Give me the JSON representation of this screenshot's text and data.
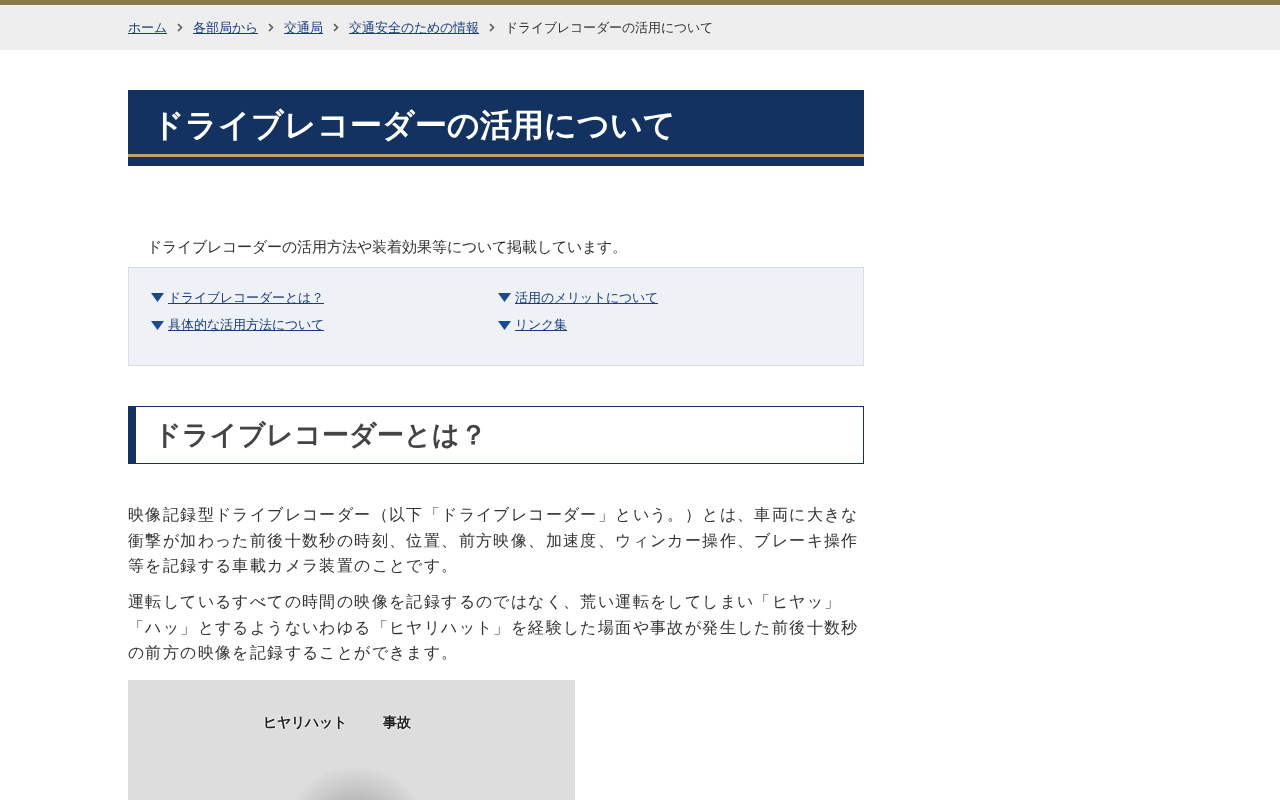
{
  "breadcrumb": [
    {
      "label": "ホーム",
      "link": true
    },
    {
      "label": "各部局から",
      "link": true
    },
    {
      "label": "交通局",
      "link": true
    },
    {
      "label": "交通安全のための情報",
      "link": true
    },
    {
      "label": "ドライブレコーダーの活用について",
      "link": false
    }
  ],
  "page_title": "ドライブレコーダーの活用について",
  "intro": "ドライブレコーダーの活用方法や装着効果等について掲載しています。",
  "toc": [
    {
      "label": "ドライブレコーダーとは？"
    },
    {
      "label": "活用のメリットについて"
    },
    {
      "label": "具体的な活用方法について"
    },
    {
      "label": "リンク集"
    }
  ],
  "section": {
    "heading": "ドライブレコーダーとは？",
    "paragraphs": [
      "映像記録型ドライブレコーダー（以下「ドライブレコーダー」という。）とは、車両に大きな衝撃が加わった前後十数秒の時刻、位置、前方映像、加速度、ウィンカー操作、ブレーキ操作等を記録する車載カメラ装置のことです。",
      "運転しているすべての時間の映像を記録するのではなく、荒い運転をしてしまい「ヒヤッ」「ハッ」とするようないわゆる「ヒヤリハット」を経験した場面や事故が発生した前後十数秒の前方の映像を記録することができます。"
    ],
    "figure": {
      "labels": [
        "ヒヤリハット",
        "事故"
      ]
    }
  }
}
